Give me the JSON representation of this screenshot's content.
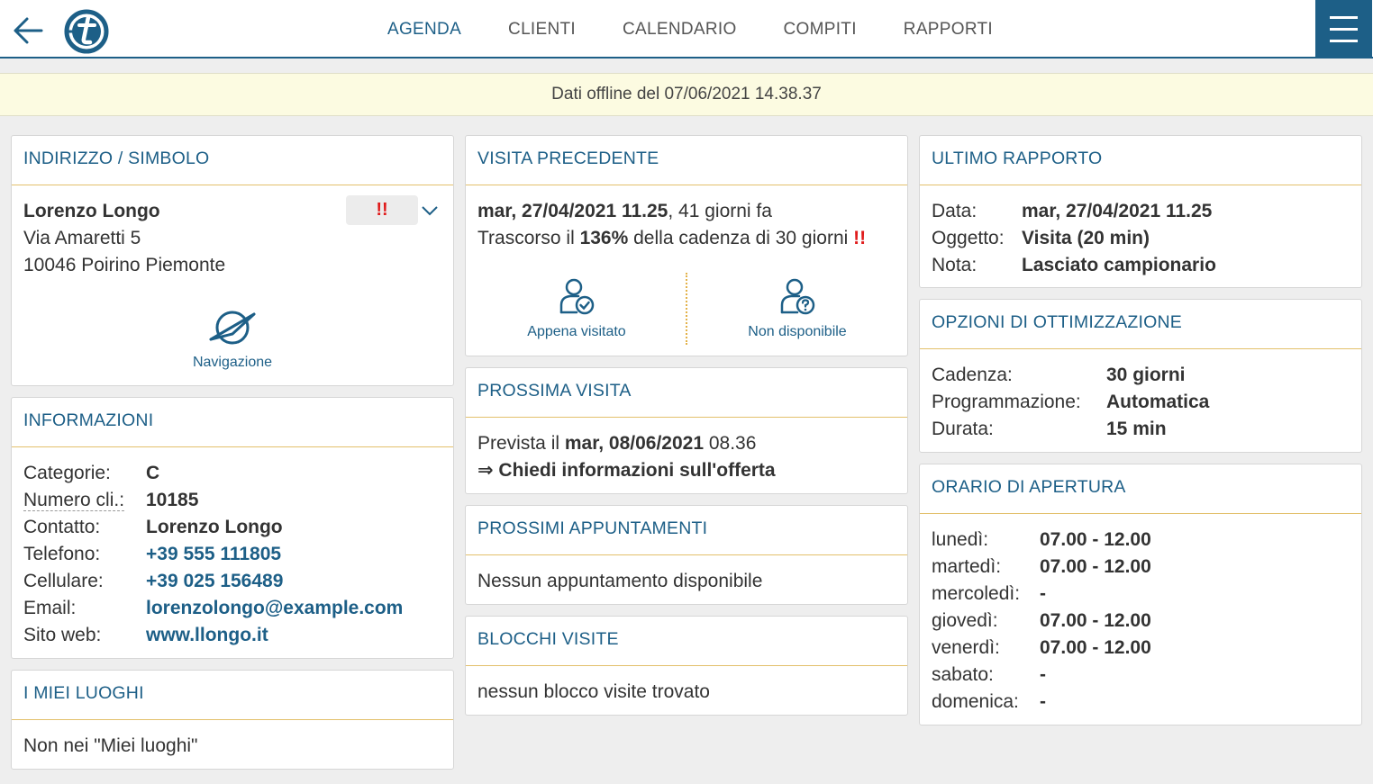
{
  "nav": {
    "tabs": [
      {
        "label": "AGENDA",
        "active": true
      },
      {
        "label": "CLIENTI"
      },
      {
        "label": "CALENDARIO"
      },
      {
        "label": "COMPITI"
      },
      {
        "label": "RAPPORTI"
      }
    ],
    "accent_color": "#1d5f87"
  },
  "offline_banner": "Dati offline del 07/06/2021 14.38.37",
  "address": {
    "title": "INDIRIZZO / SIMBOLO",
    "name": "Lorenzo Longo",
    "street": "Via Amaretti 5",
    "city": "10046 Poirino Piemonte",
    "priority": "!!",
    "navigation_label": "Navigazione"
  },
  "info": {
    "title": "INFORMAZIONI",
    "rows": [
      {
        "label": "Categorie:",
        "value": "C"
      },
      {
        "label": "Numero cli.:",
        "value": "10185"
      },
      {
        "label": "Contatto:",
        "value": "Lorenzo Longo"
      },
      {
        "label": "Telefono:",
        "value": "+39 555 111805"
      },
      {
        "label": "Cellulare:",
        "value": "+39 025 156489"
      },
      {
        "label": "Email:",
        "value": "lorenzolongo@example.com"
      },
      {
        "label": "Sito web:",
        "value": "www.llongo.it"
      }
    ]
  },
  "places": {
    "title": "I MIEI LUOGHI",
    "text": "Non nei \"Miei luoghi\""
  },
  "previous_visit": {
    "title": "VISITA PRECEDENTE",
    "date": "mar, 27/04/2021 11.25",
    "ago": ", 41 giorni fa",
    "cadence_prefix": "Trascorso il ",
    "cadence_pct": "136%",
    "cadence_suffix": " della cadenza di 30 giorni",
    "warn": "!!",
    "action_visited": "Appena visitato",
    "action_unavailable": "Non disponibile"
  },
  "next_visit": {
    "title": "PROSSIMA VISITA",
    "prefix": "Prevista il ",
    "date": "mar, 08/06/2021",
    "time": " 08.36",
    "task": "⇒ Chiedi informazioni sull'offerta"
  },
  "appointments": {
    "title": "PROSSIMI APPUNTAMENTI",
    "text": "Nessun appuntamento disponibile"
  },
  "blocks": {
    "title": "BLOCCHI VISITE",
    "text": "nessun blocco visite trovato"
  },
  "last_report": {
    "title": "ULTIMO RAPPORTO",
    "rows": [
      {
        "label": "Data:",
        "value": "mar, 27/04/2021 11.25"
      },
      {
        "label": "Oggetto:",
        "value": "Visita (20 min)"
      },
      {
        "label": "Nota:",
        "value": "Lasciato campionario"
      }
    ]
  },
  "optimization": {
    "title": "OPZIONI DI OTTIMIZZAZIONE",
    "rows": [
      {
        "label": "Cadenza:",
        "value": "30 giorni"
      },
      {
        "label": "Programmazione:",
        "value": "Automatica"
      },
      {
        "label": "Durata:",
        "value": "15 min"
      }
    ]
  },
  "opening_hours": {
    "title": "ORARIO DI APERTURA",
    "rows": [
      {
        "label": "lunedì:",
        "value": "07.00 - 12.00"
      },
      {
        "label": "martedì:",
        "value": "07.00 - 12.00"
      },
      {
        "label": "mercoledì:",
        "value": "-"
      },
      {
        "label": "giovedì:",
        "value": "07.00 - 12.00"
      },
      {
        "label": "venerdì:",
        "value": "07.00 - 12.00"
      },
      {
        "label": "sabato:",
        "value": "-"
      },
      {
        "label": "domenica:",
        "value": "-"
      }
    ]
  }
}
